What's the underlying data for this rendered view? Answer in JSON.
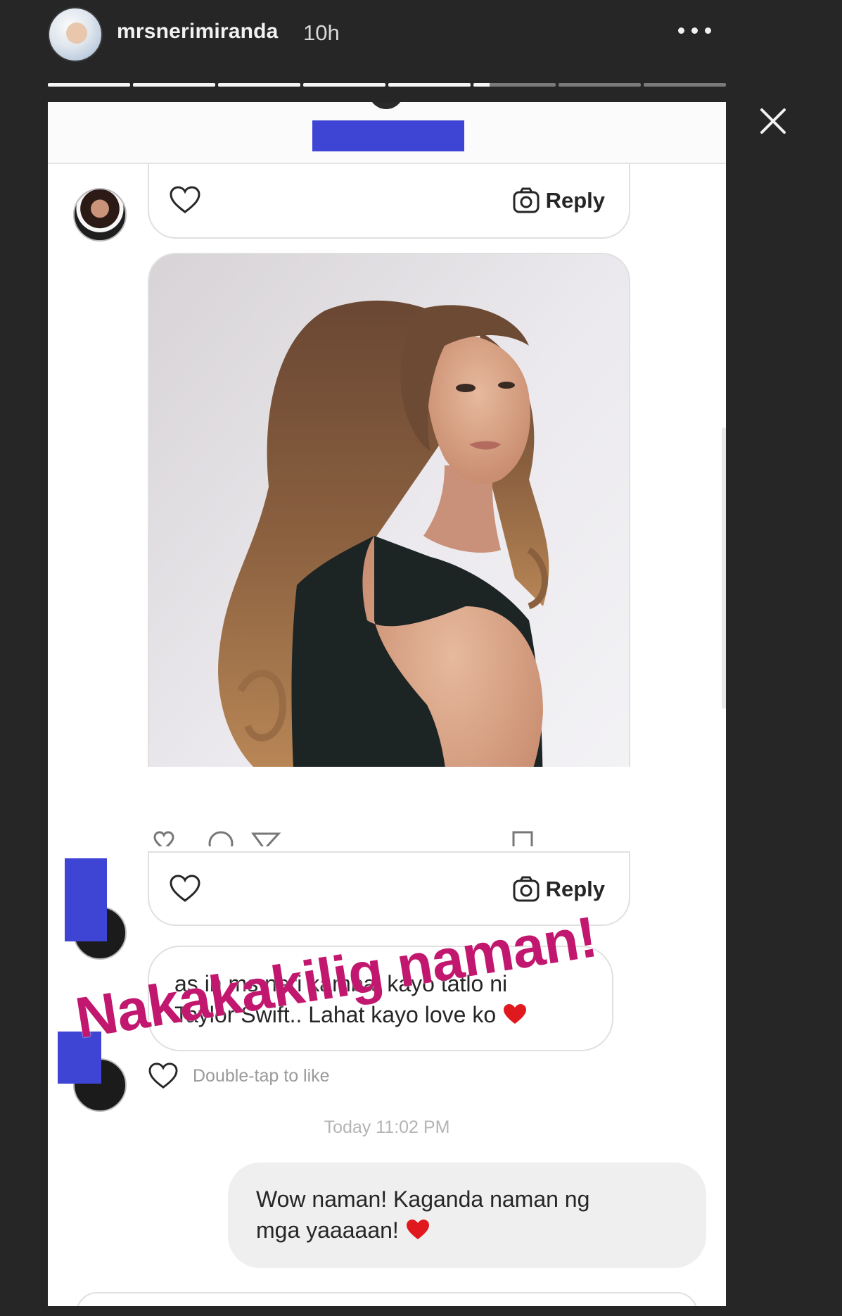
{
  "story": {
    "username": "mrsnerimiranda",
    "time": "10h",
    "progress_segments": [
      1,
      1,
      1,
      1,
      1,
      0.2,
      0,
      0
    ]
  },
  "dm": {
    "reply_label": "Reply",
    "message_text_line1": "as in ms neri kambal kayo tatlo ni",
    "message_text_line2": "Taylor Swift.. Lahat kayo love ko",
    "double_tap_text": "Double-tap to like",
    "timestamp": "Today 11:02 PM",
    "sent_text_line1": "Wow naman! Kaganda naman ng",
    "sent_text_line2": "mga yaaaaan!"
  },
  "overlay": {
    "text": "Nakakakilig naman!"
  },
  "colors": {
    "redaction": "#3e44d4",
    "overlay_text": "#c2176f",
    "heart": "#e0191e"
  }
}
